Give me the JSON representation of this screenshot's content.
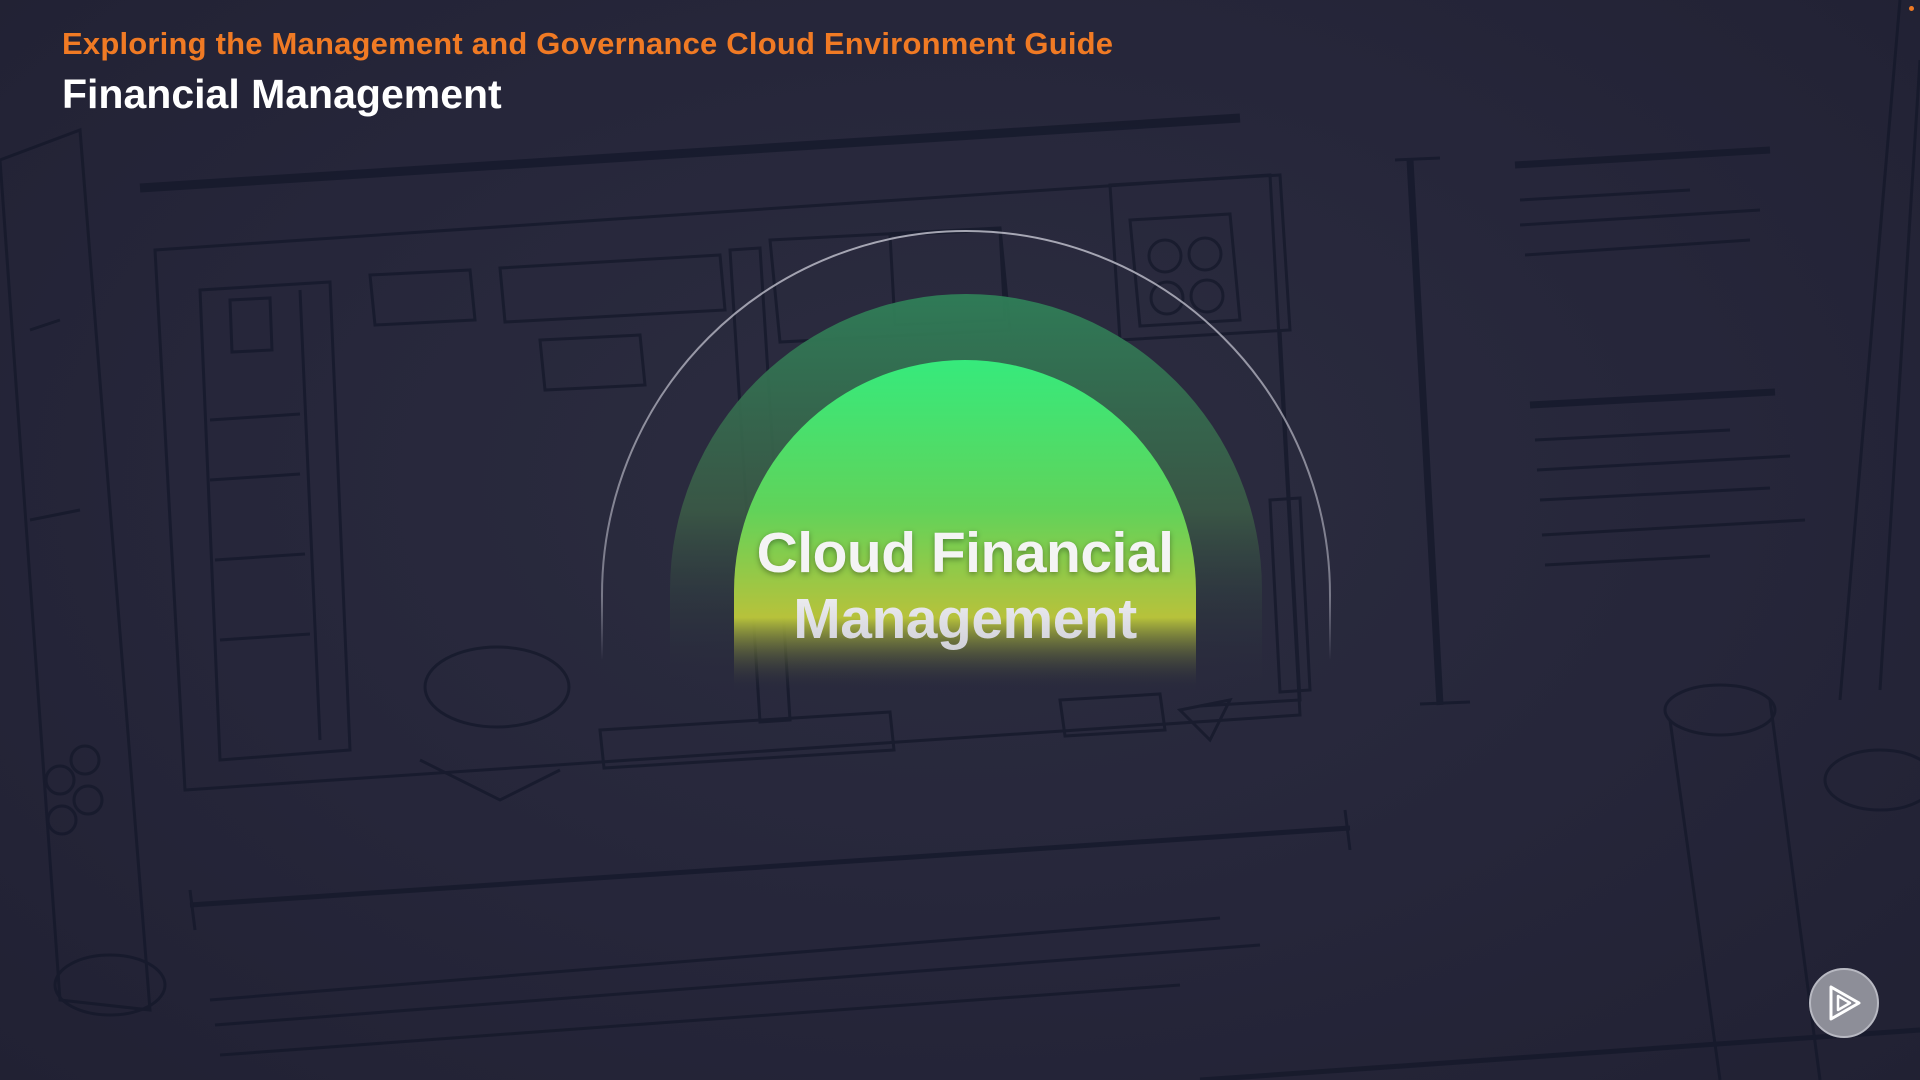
{
  "header": {
    "course_title": "Exploring the Management and Governance Cloud Environment Guide",
    "module_title": "Financial Management"
  },
  "hero": {
    "title_line1": "Cloud Financial",
    "title_line2": "Management"
  },
  "icons": {
    "play_button": "play-logo-icon",
    "corner_indicator": "dot-icon"
  },
  "colors": {
    "background": "#262636",
    "accent_orange": "#f07a24",
    "hero_green": "#3ee87a",
    "hero_yellow": "#c9c23a",
    "title_white": "#ffffff"
  }
}
